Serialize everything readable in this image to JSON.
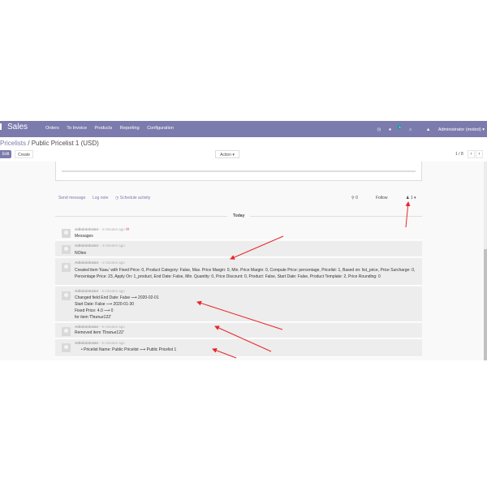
{
  "navbar": {
    "app_name": "Sales",
    "menu": [
      "Orders",
      "To Invoice",
      "Products",
      "Reporting",
      "Configuration"
    ],
    "messages_badge": "3",
    "user": "Administrator (mobot)"
  },
  "breadcrumb": {
    "parent": "Pricelists",
    "separator": " / ",
    "current": "Public Pricelist 1 (USD)"
  },
  "buttons": {
    "edit": "Edit",
    "create": "Create",
    "action": "Action ▾"
  },
  "pager": {
    "value": "1 / 8",
    "prev": "‹",
    "next": "›"
  },
  "chatter": {
    "send_message": "Send message",
    "log_note": "Log note",
    "schedule_activity": "Schedule activity",
    "attachments_count": "0",
    "follow": "Follow",
    "followers_count": "1",
    "today": "Today"
  },
  "messages": [
    {
      "author": "Administrator",
      "time": " - 4 minutes ago",
      "lines": [
        "Messages"
      ]
    },
    {
      "author": "Administrator",
      "time": " - 4 minutes ago",
      "lines": [
        "NOtes"
      ]
    },
    {
      "author": "Administrator",
      "time": " - 4 minutes ago",
      "lines": [
        "Created item 'Кань' with Fixed Price: 0, Product Category: False, Max. Price Margin: 0, Min. Price Margin: 0, Compute Price: percentage, Pricelist: 1, Based on: list_price, Price Surcharge: 0, Percentage Price: 23, Apply On: 1_product, End Date: False, Min. Quantity: 0, Price Discount: 0, Product: False, Start Date: False, Product Template: 2, Price Rounding: 0"
      ]
    },
    {
      "author": "Administrator",
      "time": " - 5 minutes ago",
      "lines": [
        "Changed field End Date: False ⟶ 2020-02-01",
        "Start Date: False ⟶ 2020-01-30",
        "Fixed Price: 4.0 ⟶ 0",
        "for item 'Ппатье122'"
      ]
    },
    {
      "author": "Administrator",
      "time": " - 5 minutes ago",
      "lines": [
        "Removed item 'Платье122'"
      ]
    },
    {
      "author": "Administrator",
      "time": " - 5 minutes ago",
      "lines": [
        "•  Pricelist Name: Public Pricelist ⟶ Public Pricelist 1"
      ]
    }
  ],
  "colors": {
    "navbar": "#7c7bad",
    "primary": "#7c7bad",
    "annotation_arrow": "#e8262b",
    "message_bg": "#ededed"
  }
}
